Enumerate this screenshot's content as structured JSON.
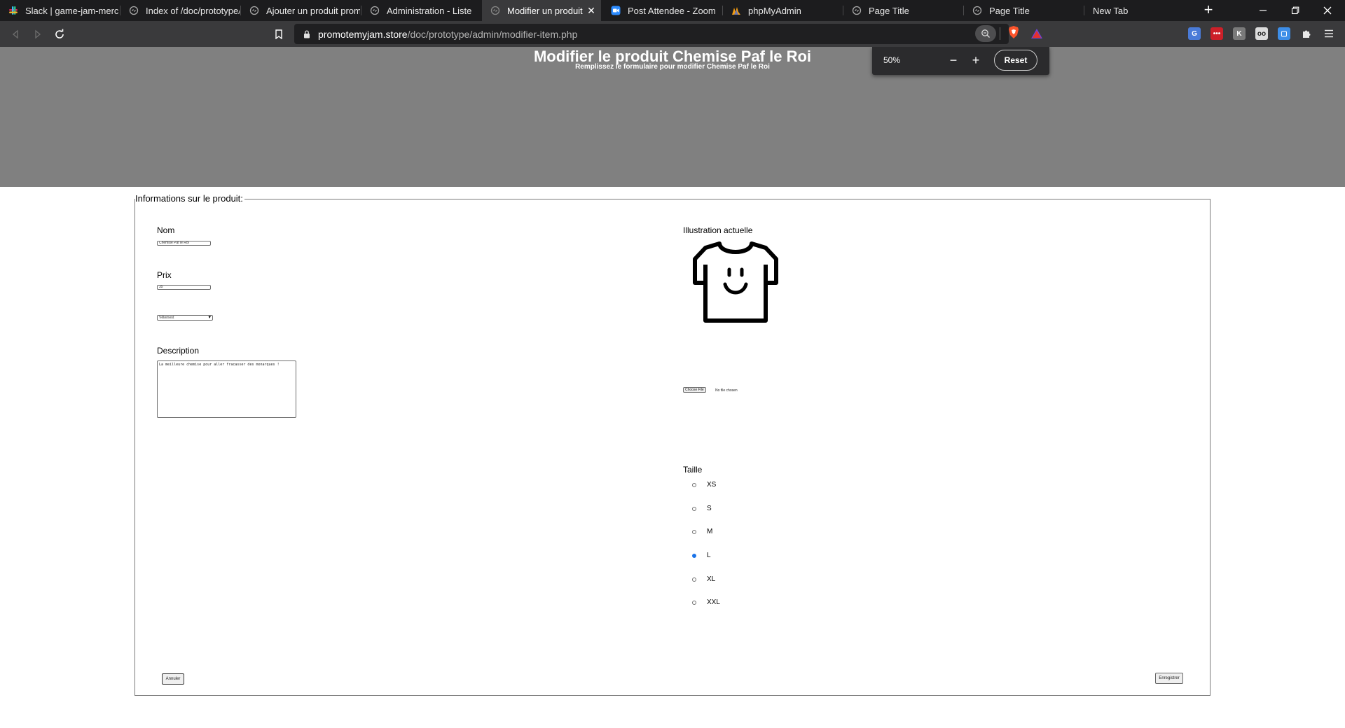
{
  "browser": {
    "tabs": [
      {
        "label": "Slack | game-jam-merch",
        "icon": "slack-icon"
      },
      {
        "label": "Index of /doc/prototype/",
        "icon": "globe-icon"
      },
      {
        "label": "Ajouter un produit prom",
        "icon": "globe-icon"
      },
      {
        "label": "Administration - Liste",
        "icon": "globe-icon"
      },
      {
        "label": "Modifier un produit",
        "icon": "globe-icon",
        "active": true
      },
      {
        "label": "Post Attendee - Zoom",
        "icon": "zoom-icon"
      },
      {
        "label": "phpMyAdmin",
        "icon": "phpmyadmin-icon"
      },
      {
        "label": "Page Title",
        "icon": "globe-icon"
      },
      {
        "label": "Page Title",
        "icon": "globe-icon"
      },
      {
        "label": "New Tab",
        "icon": ""
      }
    ],
    "close_glyph": "✕",
    "url_host": "promotemyjam.store",
    "url_path": "/doc/prototype/admin/modifier-item.php",
    "zoom": {
      "value": "50%",
      "minus": "−",
      "plus": "+",
      "reset": "Reset"
    }
  },
  "page": {
    "title": "Modifier le produit Chemise Paf le Roi",
    "subtitle": "Remplissez le formulaire pour modifier Chemise Paf le Roi",
    "legend": "Informations sur le produit:",
    "form": {
      "nom_label": "Nom",
      "nom_value": "Chemise Paf le Roi",
      "prix_label": "Prix",
      "prix_value": "35",
      "category_value": "Vêtement",
      "description_label": "Description",
      "description_value": "La meilleure chemise pour aller fracasser des monarques !",
      "illustration_label": "Illustration actuelle",
      "file_button": "Choose File",
      "file_status": "No file chosen",
      "taille_label": "Taille",
      "sizes": [
        {
          "label": "XS",
          "checked": false
        },
        {
          "label": "S",
          "checked": false
        },
        {
          "label": "M",
          "checked": false
        },
        {
          "label": "L",
          "checked": true
        },
        {
          "label": "XL",
          "checked": false
        },
        {
          "label": "XXL",
          "checked": false
        }
      ],
      "cancel_button": "Annuler",
      "save_button": "Enregistrer"
    }
  },
  "colors": {
    "header_band": "#808080",
    "radio_checked": "#1a73e8",
    "tabbar": "#1c1c1e",
    "toolbar": "#3a3a3c"
  }
}
